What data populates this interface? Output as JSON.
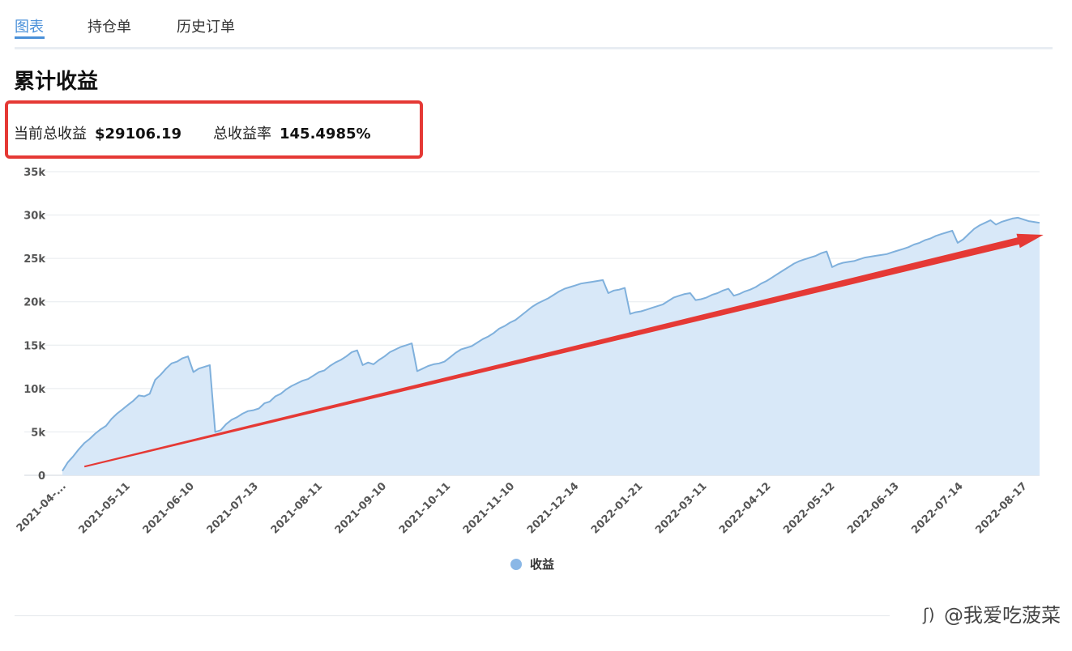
{
  "tabs": [
    {
      "label": "图表",
      "active": true
    },
    {
      "label": "持仓单",
      "active": false
    },
    {
      "label": "历史订单",
      "active": false
    }
  ],
  "page_title": "累计收益",
  "stats": {
    "total_profit_label": "当前总收益",
    "total_profit_value": "$29106.19",
    "total_rate_label": "总收益率",
    "total_rate_value": "145.4985%"
  },
  "watermark": "@我爱吃菠菜",
  "colors": {
    "accent": "#4a90d9",
    "series_line": "#7fb0dc",
    "series_fill": "#d8e8f8",
    "annotation_red": "#e53935"
  },
  "chart_data": {
    "type": "area",
    "ylim": [
      0,
      35000
    ],
    "yticks": [
      "0",
      "5k",
      "10k",
      "15k",
      "20k",
      "25k",
      "30k",
      "35k"
    ],
    "ytick_values": [
      0,
      5000,
      10000,
      15000,
      20000,
      25000,
      30000,
      35000
    ],
    "xticks": [
      "2021-04-...",
      "2021-05-11",
      "2021-06-10",
      "2021-07-13",
      "2021-08-11",
      "2021-09-10",
      "2021-10-11",
      "2021-11-10",
      "2021-12-14",
      "2022-01-21",
      "2022-03-11",
      "2022-04-12",
      "2022-05-12",
      "2022-06-13",
      "2022-07-14",
      "2022-08-17"
    ],
    "grid": true,
    "legend_position": "bottom-center",
    "series": [
      {
        "name": "收益",
        "values": [
          500,
          1500,
          2200,
          3000,
          3700,
          4200,
          4800,
          5300,
          5700,
          6500,
          7100,
          7600,
          8100,
          8600,
          9200,
          9100,
          9400,
          11000,
          11600,
          12300,
          12900,
          13100,
          13500,
          13700,
          11900,
          12300,
          12500,
          12700,
          5000,
          5200,
          5900,
          6400,
          6700,
          7100,
          7400,
          7500,
          7700,
          8300,
          8500,
          9100,
          9400,
          9900,
          10300,
          10600,
          10900,
          11100,
          11500,
          11900,
          12100,
          12600,
          13000,
          13300,
          13700,
          14200,
          14400,
          12700,
          13000,
          12800,
          13300,
          13700,
          14200,
          14500,
          14800,
          15000,
          15200,
          12000,
          12300,
          12600,
          12800,
          12900,
          13100,
          13600,
          14100,
          14500,
          14700,
          14900,
          15300,
          15700,
          16000,
          16400,
          16900,
          17200,
          17600,
          17900,
          18400,
          18900,
          19400,
          19800,
          20100,
          20400,
          20800,
          21200,
          21500,
          21700,
          21900,
          22100,
          22200,
          22300,
          22400,
          22500,
          21000,
          21300,
          21400,
          21600,
          18600,
          18800,
          18900,
          19100,
          19300,
          19500,
          19700,
          20100,
          20500,
          20700,
          20900,
          21000,
          20200,
          20300,
          20500,
          20800,
          21000,
          21300,
          21500,
          20700,
          20900,
          21200,
          21400,
          21700,
          22100,
          22400,
          22800,
          23200,
          23600,
          24000,
          24400,
          24700,
          24900,
          25100,
          25300,
          25600,
          25800,
          24000,
          24300,
          24500,
          24600,
          24700,
          24900,
          25100,
          25200,
          25300,
          25400,
          25500,
          25700,
          25900,
          26100,
          26300,
          26600,
          26800,
          27100,
          27300,
          27600,
          27800,
          28000,
          28200,
          26800,
          27200,
          27800,
          28400,
          28800,
          29100,
          29400,
          28900,
          29200,
          29400,
          29600,
          29700,
          29500,
          29300,
          29200,
          29100
        ]
      }
    ],
    "annotations": [
      {
        "type": "arrow",
        "from": [
          0.02,
          1000
        ],
        "to": [
          1.0,
          27500
        ]
      }
    ]
  }
}
